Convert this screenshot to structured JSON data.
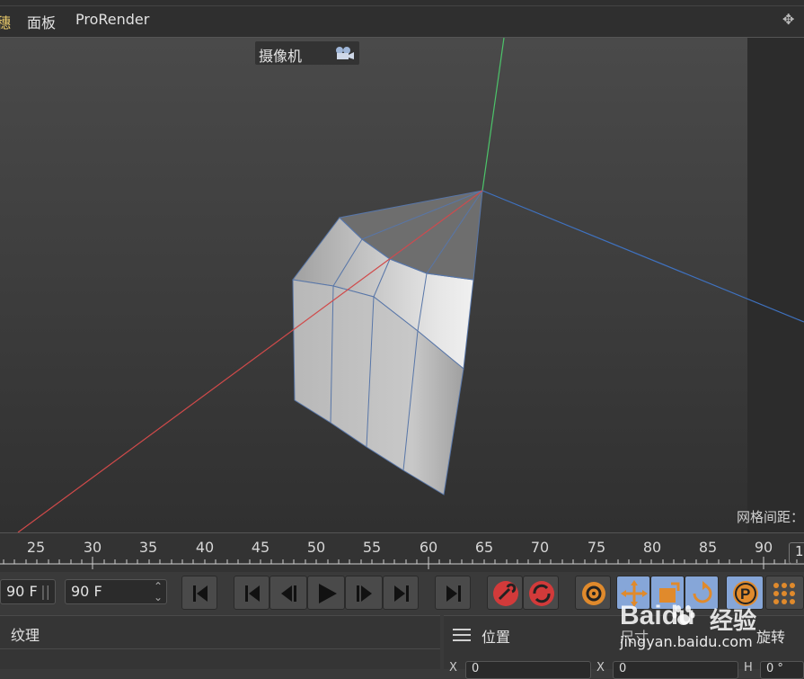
{
  "menubar": {
    "items": [
      "穗",
      "面板",
      "ProRender"
    ]
  },
  "viewport": {
    "camera_label": "摄像机",
    "grid_spacing_label": "网格间距："
  },
  "timeline": {
    "ticks": [
      "25",
      "30",
      "35",
      "40",
      "45",
      "50",
      "55",
      "60",
      "65",
      "70",
      "75",
      "80",
      "85",
      "90"
    ],
    "frame_box": "1"
  },
  "transport": {
    "start_frame": "90 F",
    "end_frame": "90 F"
  },
  "panels": {
    "left_tab": "纹理",
    "right_position": "位置",
    "right_size": "尺寸",
    "right_rotation": "旋转",
    "coord_x": "X",
    "coord_x_value": "0",
    "coord_x2": "X",
    "coord_x2_value": "0",
    "coord_h": "H",
    "coord_h_value": "0 °"
  },
  "watermark": {
    "brand": "Bai",
    "brand_tail": "du",
    "cn": "经验",
    "url": "jingyan.baidu.com"
  },
  "colors": {
    "axis_x": "#d04a4a",
    "axis_y": "#4cc46a",
    "axis_z": "#3f72c0",
    "active_tool": "#86a6d8",
    "record_red": "#d23a3a",
    "orange": "#e08a2c"
  }
}
